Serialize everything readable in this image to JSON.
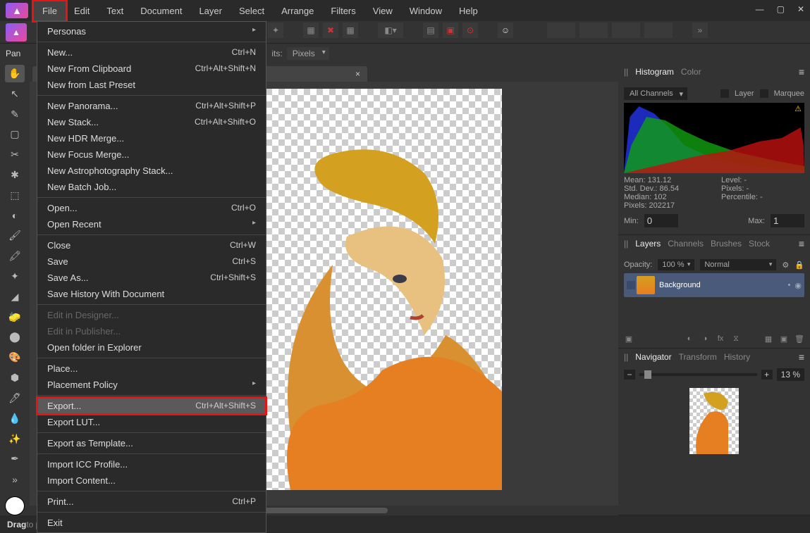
{
  "menubar": [
    "File",
    "Edit",
    "Text",
    "Document",
    "Layer",
    "Select",
    "Arrange",
    "Filters",
    "View",
    "Window",
    "Help"
  ],
  "context": {
    "tool_label": "Pan",
    "units_label": "its:",
    "units_value": "Pixels"
  },
  "file_menu": {
    "personas": "Personas",
    "new": "New...",
    "new_sc": "Ctrl+N",
    "clip": "New From Clipboard",
    "clip_sc": "Ctrl+Alt+Shift+N",
    "preset": "New from Last Preset",
    "pano": "New Panorama...",
    "pano_sc": "Ctrl+Alt+Shift+P",
    "stack": "New Stack...",
    "stack_sc": "Ctrl+Alt+Shift+O",
    "hdr": "New HDR Merge...",
    "focus": "New Focus Merge...",
    "astro": "New Astrophotography Stack...",
    "batch": "New Batch Job...",
    "open": "Open...",
    "open_sc": "Ctrl+O",
    "recent": "Open Recent",
    "close": "Close",
    "close_sc": "Ctrl+W",
    "save": "Save",
    "save_sc": "Ctrl+S",
    "saveas": "Save As...",
    "saveas_sc": "Ctrl+Shift+S",
    "savehist": "Save History With Document",
    "designer": "Edit in Designer...",
    "publisher": "Edit in Publisher...",
    "explorer": "Open folder in Explorer",
    "place": "Place...",
    "policy": "Placement Policy",
    "export": "Export...",
    "export_sc": "Ctrl+Alt+Shift+S",
    "lut": "Export LUT...",
    "template": "Export as Template...",
    "icc": "Import ICC Profile...",
    "content": "Import Content...",
    "print": "Print...",
    "print_sc": "Ctrl+P",
    "exit": "Exit"
  },
  "doc_tab": {
    "title": "",
    "close": "×"
  },
  "histogram": {
    "tab1": "Histogram",
    "tab2": "Color",
    "channels": "All Channels",
    "cb1": "Layer",
    "cb2": "Marquee",
    "mean_l": "Mean:",
    "mean_v": "131.12",
    "sd_l": "Std. Dev.:",
    "sd_v": "86.54",
    "med_l": "Median:",
    "med_v": "102",
    "px_l": "Pixels:",
    "px_v": "202217",
    "lvl_l": "Level:",
    "lvl_v": "-",
    "px2_l": "Pixels:",
    "px2_v": "-",
    "pct_l": "Percentile:",
    "pct_v": "-",
    "min_l": "Min:",
    "min_v": "0",
    "max_l": "Max:",
    "max_v": "1"
  },
  "layers": {
    "t1": "Layers",
    "t2": "Channels",
    "t3": "Brushes",
    "t4": "Stock",
    "opacity_l": "Opacity:",
    "opacity_v": "100 %",
    "blend": "Normal",
    "layer_name": "Background"
  },
  "navigator": {
    "t1": "Navigator",
    "t2": "Transform",
    "t3": "History",
    "zoom": "13 %"
  },
  "status": {
    "b": "Drag",
    "rest": " to pan view."
  },
  "tools": [
    "✋",
    "↖",
    "✎",
    "▢",
    "✂",
    "✱",
    "⬚",
    "◐",
    "🖌",
    "🖍",
    "✦",
    "◢",
    "🧽",
    "⬤",
    "🎨",
    "⬢",
    "🖊",
    "💧",
    "✨",
    "✒",
    "»"
  ]
}
